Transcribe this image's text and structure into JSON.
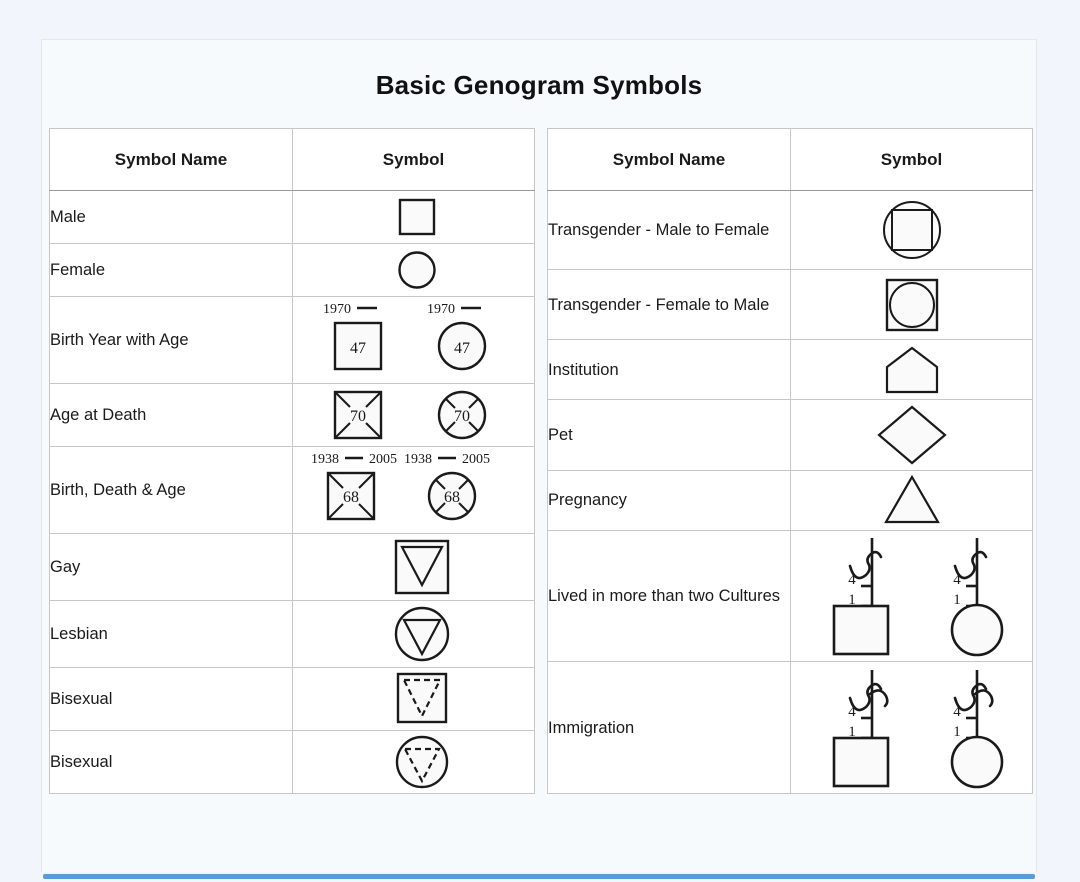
{
  "page": {
    "title": "Basic Genogram Symbols",
    "background_color": "#f2f6fc",
    "card_color": "#f7fafd",
    "accent_color": "#5b9bd5",
    "shape_fill": "#fafafa",
    "shape_stroke": "#1a1a1a"
  },
  "left_table": {
    "headers": {
      "name": "Symbol Name",
      "symbol": "Symbol"
    },
    "rows": [
      {
        "name": "Male",
        "symbol": "square"
      },
      {
        "name": "Female",
        "symbol": "circle"
      },
      {
        "name": "Birth Year with Age",
        "symbol": "birth-year-pair",
        "birth_year": "1970",
        "age": "47"
      },
      {
        "name": "Age at Death",
        "symbol": "age-at-death-pair",
        "age": "70"
      },
      {
        "name": "Birth, Death & Age",
        "symbol": "birth-death-age-pair",
        "birth_year": "1938",
        "death_year": "2005",
        "age": "68"
      },
      {
        "name": "Gay",
        "symbol": "square-with-triangle"
      },
      {
        "name": "Lesbian",
        "symbol": "circle-with-triangle"
      },
      {
        "name": "Bisexual",
        "symbol": "square-with-dashed-triangle"
      },
      {
        "name": "Bisexual",
        "symbol": "circle-with-dashed-triangle"
      }
    ]
  },
  "right_table": {
    "headers": {
      "name": "Symbol Name",
      "symbol": "Symbol"
    },
    "rows": [
      {
        "name": "Transgender - Male to Female",
        "symbol": "square-inside-circle"
      },
      {
        "name": "Transgender - Female to Male",
        "symbol": "circle-inside-square"
      },
      {
        "name": "Institution",
        "symbol": "house-pentagon"
      },
      {
        "name": "Pet",
        "symbol": "diamond"
      },
      {
        "name": "Pregnancy",
        "symbol": "triangle"
      },
      {
        "name": "Lived in more than two Cultures",
        "symbol": "migration-pair",
        "upper_label": "4",
        "lower_label": "1"
      },
      {
        "name": "Immigration",
        "symbol": "migration-pair",
        "upper_label": "4",
        "lower_label": "1"
      }
    ]
  }
}
